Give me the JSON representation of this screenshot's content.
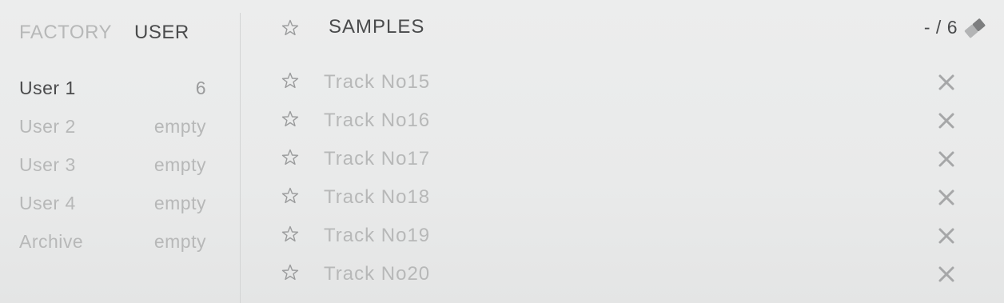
{
  "tabs": {
    "factory_label": "FACTORY",
    "user_label": "USER",
    "active": "USER"
  },
  "banks": [
    {
      "name": "User 1",
      "count": "6",
      "selected": true
    },
    {
      "name": "User 2",
      "count": "empty",
      "selected": false
    },
    {
      "name": "User 3",
      "count": "empty",
      "selected": false
    },
    {
      "name": "User 4",
      "count": "empty",
      "selected": false
    },
    {
      "name": "Archive",
      "count": "empty",
      "selected": false
    }
  ],
  "header": {
    "title": "SAMPLES",
    "count": "- / 6",
    "star_icon": "star-outline-icon",
    "eraser_icon": "eraser-icon"
  },
  "tracks": [
    {
      "name": "Track No15"
    },
    {
      "name": "Track No16"
    },
    {
      "name": "Track No17"
    },
    {
      "name": "Track No18"
    },
    {
      "name": "Track No19"
    },
    {
      "name": "Track No20"
    }
  ],
  "colors": {
    "background": "#eaebeb",
    "text_active": "#4a4b4c",
    "text_inactive": "#b7b8b8",
    "icon": "#9a9b9c",
    "divider": "#d3d4d4"
  }
}
